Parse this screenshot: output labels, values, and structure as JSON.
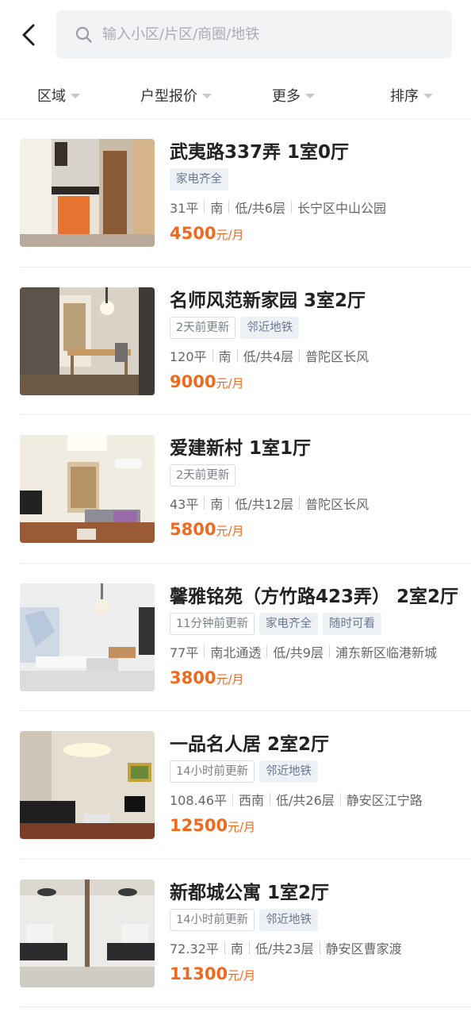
{
  "header": {
    "back_icon": "chevron-left-icon",
    "search_icon": "search-icon",
    "search_placeholder": "输入小区/片区/商圈/地铁",
    "search_value": ""
  },
  "filters": [
    {
      "label": "区域"
    },
    {
      "label": "户型报价"
    },
    {
      "label": "更多"
    },
    {
      "label": "排序"
    }
  ],
  "listings": [
    {
      "title": "武夷路337弄 1室0厅",
      "tags": [
        {
          "text": "家电齐全",
          "style": "filled"
        }
      ],
      "area": "31平",
      "orientation": "南",
      "floor": "低/共6层",
      "location": "长宁区中山公园",
      "price": "4500",
      "price_unit": "元/月"
    },
    {
      "title": "名师风范新家园 3室2厅",
      "tags": [
        {
          "text": "2天前更新",
          "style": "outline"
        },
        {
          "text": "邻近地铁",
          "style": "filled"
        }
      ],
      "area": "120平",
      "orientation": "南",
      "floor": "低/共4层",
      "location": "普陀区长风",
      "price": "9000",
      "price_unit": "元/月"
    },
    {
      "title": "爱建新村 1室1厅",
      "tags": [
        {
          "text": "2天前更新",
          "style": "outline"
        }
      ],
      "area": "43平",
      "orientation": "南",
      "floor": "低/共12层",
      "location": "普陀区长风",
      "price": "5800",
      "price_unit": "元/月"
    },
    {
      "title": "馨雅铭苑（方竹路423弄） 2室2厅",
      "tags": [
        {
          "text": "11分钟前更新",
          "style": "outline"
        },
        {
          "text": "家电齐全",
          "style": "filled"
        },
        {
          "text": "随时可看",
          "style": "filled"
        }
      ],
      "area": "77平",
      "orientation": "南北通透",
      "floor": "低/共9层",
      "location": "浦东新区临港新城",
      "price": "3800",
      "price_unit": "元/月"
    },
    {
      "title": "一品名人居 2室2厅",
      "tags": [
        {
          "text": "14小时前更新",
          "style": "outline"
        },
        {
          "text": "邻近地铁",
          "style": "filled"
        }
      ],
      "area": "108.46平",
      "orientation": "西南",
      "floor": "低/共26层",
      "location": "静安区江宁路",
      "price": "12500",
      "price_unit": "元/月"
    },
    {
      "title": "新都城公寓 1室2厅",
      "tags": [
        {
          "text": "14小时前更新",
          "style": "outline"
        },
        {
          "text": "邻近地铁",
          "style": "filled"
        }
      ],
      "area": "72.32平",
      "orientation": "南",
      "floor": "低/共23层",
      "location": "静安区曹家渡",
      "price": "11300",
      "price_unit": "元/月"
    }
  ],
  "colors": {
    "price": "#ef6a1f",
    "search_bg": "#f2f3f5",
    "tag_filled_bg": "#edf1f6",
    "divider": "#ededed"
  }
}
